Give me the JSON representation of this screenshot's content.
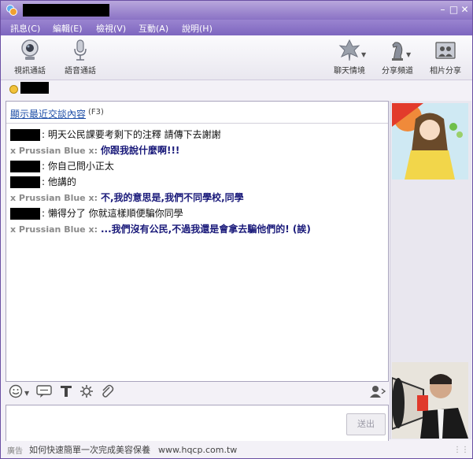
{
  "menu": [
    "訊息(C)",
    "編輯(E)",
    "檢視(V)",
    "互動(A)",
    "說明(H)"
  ],
  "toolbar": {
    "video_call": "視訊通話",
    "voice_call": "語音通話",
    "chat_mood": "聊天情境",
    "share_channel": "分享頻道",
    "photo_share": "相片分享"
  },
  "history": {
    "link": "顯示最近交談內容",
    "shortcut": "(F3)"
  },
  "messages": [
    {
      "from": "me",
      "text": ": 明天公民課要考剩下的注釋 請傳下去謝謝"
    },
    {
      "from": "other",
      "name": "x Prussian Blue x:",
      "text": "你跟我說什麼啊!!!"
    },
    {
      "from": "me",
      "text": ": 你自己問小正太"
    },
    {
      "from": "me",
      "text": ": 他講的"
    },
    {
      "from": "other",
      "name": "x Prussian Blue x:",
      "text": "不,我的意思是,我們不同學校,同學"
    },
    {
      "from": "me",
      "text": ": 懶得分了 你就這樣順便騙你同學"
    },
    {
      "from": "other",
      "name": "x Prussian Blue x:",
      "text": "...我們沒有公民,不過我還是會拿去騙他們的! (誒)"
    }
  ],
  "input": {
    "send_label": "送出"
  },
  "ad": {
    "label": "廣告",
    "text": "如何快速簡單一次完成美容保養",
    "url": "www.hqcp.com.tw"
  },
  "colors": {
    "titlebar": "#8a72c5",
    "menubar": "#7d66bf",
    "link": "#1f4fa8",
    "other_text": "#1a1a7a"
  }
}
